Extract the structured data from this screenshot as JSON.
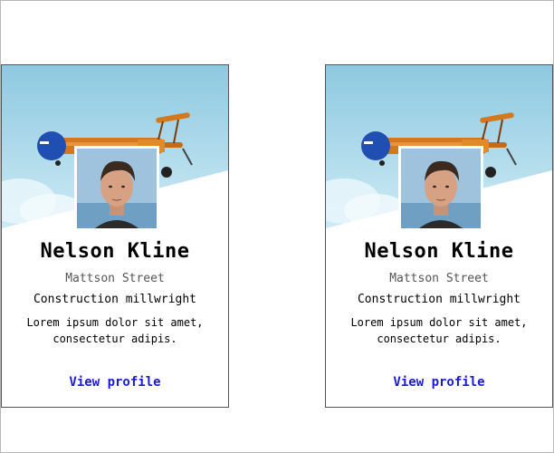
{
  "cards": [
    {
      "name": "Nelson Kline",
      "street": "Mattson Street",
      "job": "Construction millwright",
      "description": "Lorem ipsum dolor sit amet, consectetur adipis.",
      "link_label": "View profile"
    },
    {
      "name": "Nelson Kline",
      "street": "Mattson Street",
      "job": "Construction millwright",
      "description": "Lorem ipsum dolor sit amet, consectetur adipis.",
      "link_label": "View profile"
    }
  ],
  "colors": {
    "link": "#1a1ad6",
    "sky_top": "#8ec9e0",
    "sky_bottom": "#c9e8f4",
    "plane_body": "#d4781e",
    "plane_nose": "#1f4fb3"
  },
  "images": {
    "cover": "biplane-in-sky",
    "avatar": "portrait-photo"
  }
}
